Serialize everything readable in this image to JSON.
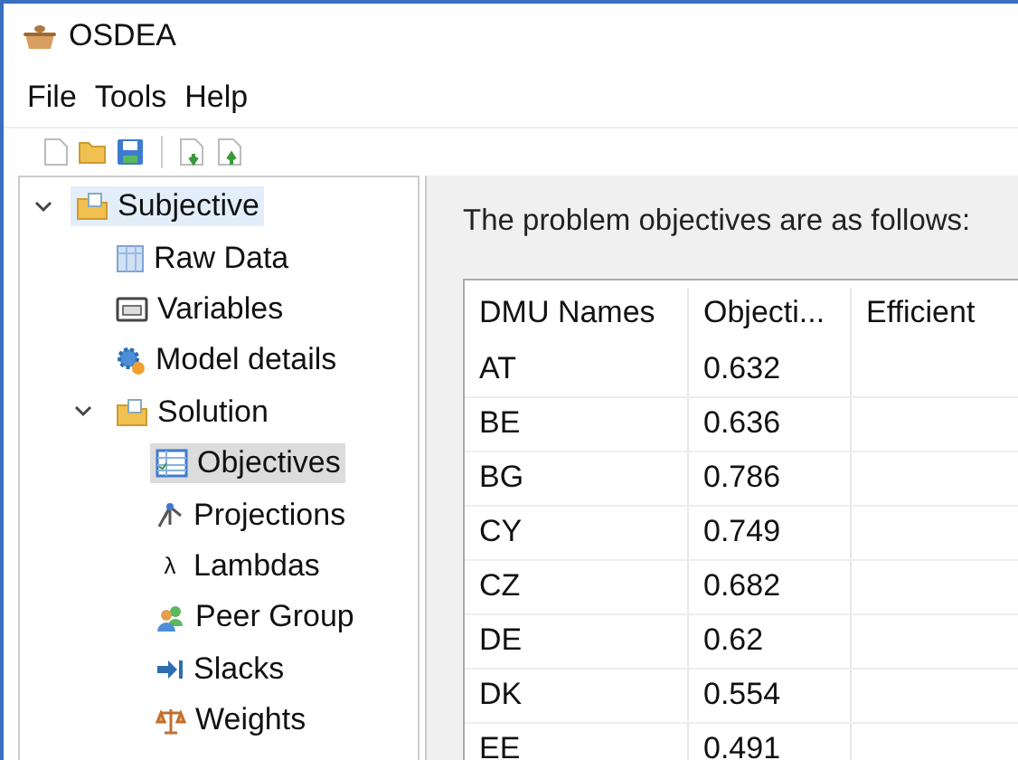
{
  "window": {
    "title": "OSDEA"
  },
  "menu": [
    "File",
    "Tools",
    "Help"
  ],
  "tree": [
    {
      "label": "Subjective",
      "kind": "folder",
      "selected": true,
      "expanded": true,
      "children": [
        {
          "label": "Raw Data",
          "kind": "table",
          "selected": false
        },
        {
          "label": "Variables",
          "kind": "variables",
          "selected": false
        },
        {
          "label": "Model details",
          "kind": "gear",
          "selected": false
        },
        {
          "label": "Solution",
          "kind": "folder",
          "selected": false,
          "expanded": true,
          "children": [
            {
              "label": "Objectives",
              "kind": "chart",
              "selected": true
            },
            {
              "label": "Projections",
              "kind": "projection",
              "selected": false
            },
            {
              "label": "Lambdas",
              "kind": "glyph",
              "glyph": "λ",
              "selected": false
            },
            {
              "label": "Peer Group",
              "kind": "people",
              "selected": false
            },
            {
              "label": "Slacks",
              "kind": "arrow",
              "selected": false
            },
            {
              "label": "Weights",
              "kind": "scale",
              "selected": false
            }
          ]
        }
      ]
    }
  ],
  "content": {
    "heading": "The problem objectives are as follows:",
    "table": {
      "columns": [
        "DMU Names",
        "Objecti...",
        "Efficient"
      ],
      "rows": [
        [
          "AT",
          "0.632",
          ""
        ],
        [
          "BE",
          "0.636",
          ""
        ],
        [
          "BG",
          "0.786",
          ""
        ],
        [
          "CY",
          "0.749",
          ""
        ],
        [
          "CZ",
          "0.682",
          ""
        ],
        [
          "DE",
          "0.62",
          ""
        ],
        [
          "DK",
          "0.554",
          ""
        ],
        [
          "EE",
          "0.491",
          ""
        ]
      ]
    }
  }
}
